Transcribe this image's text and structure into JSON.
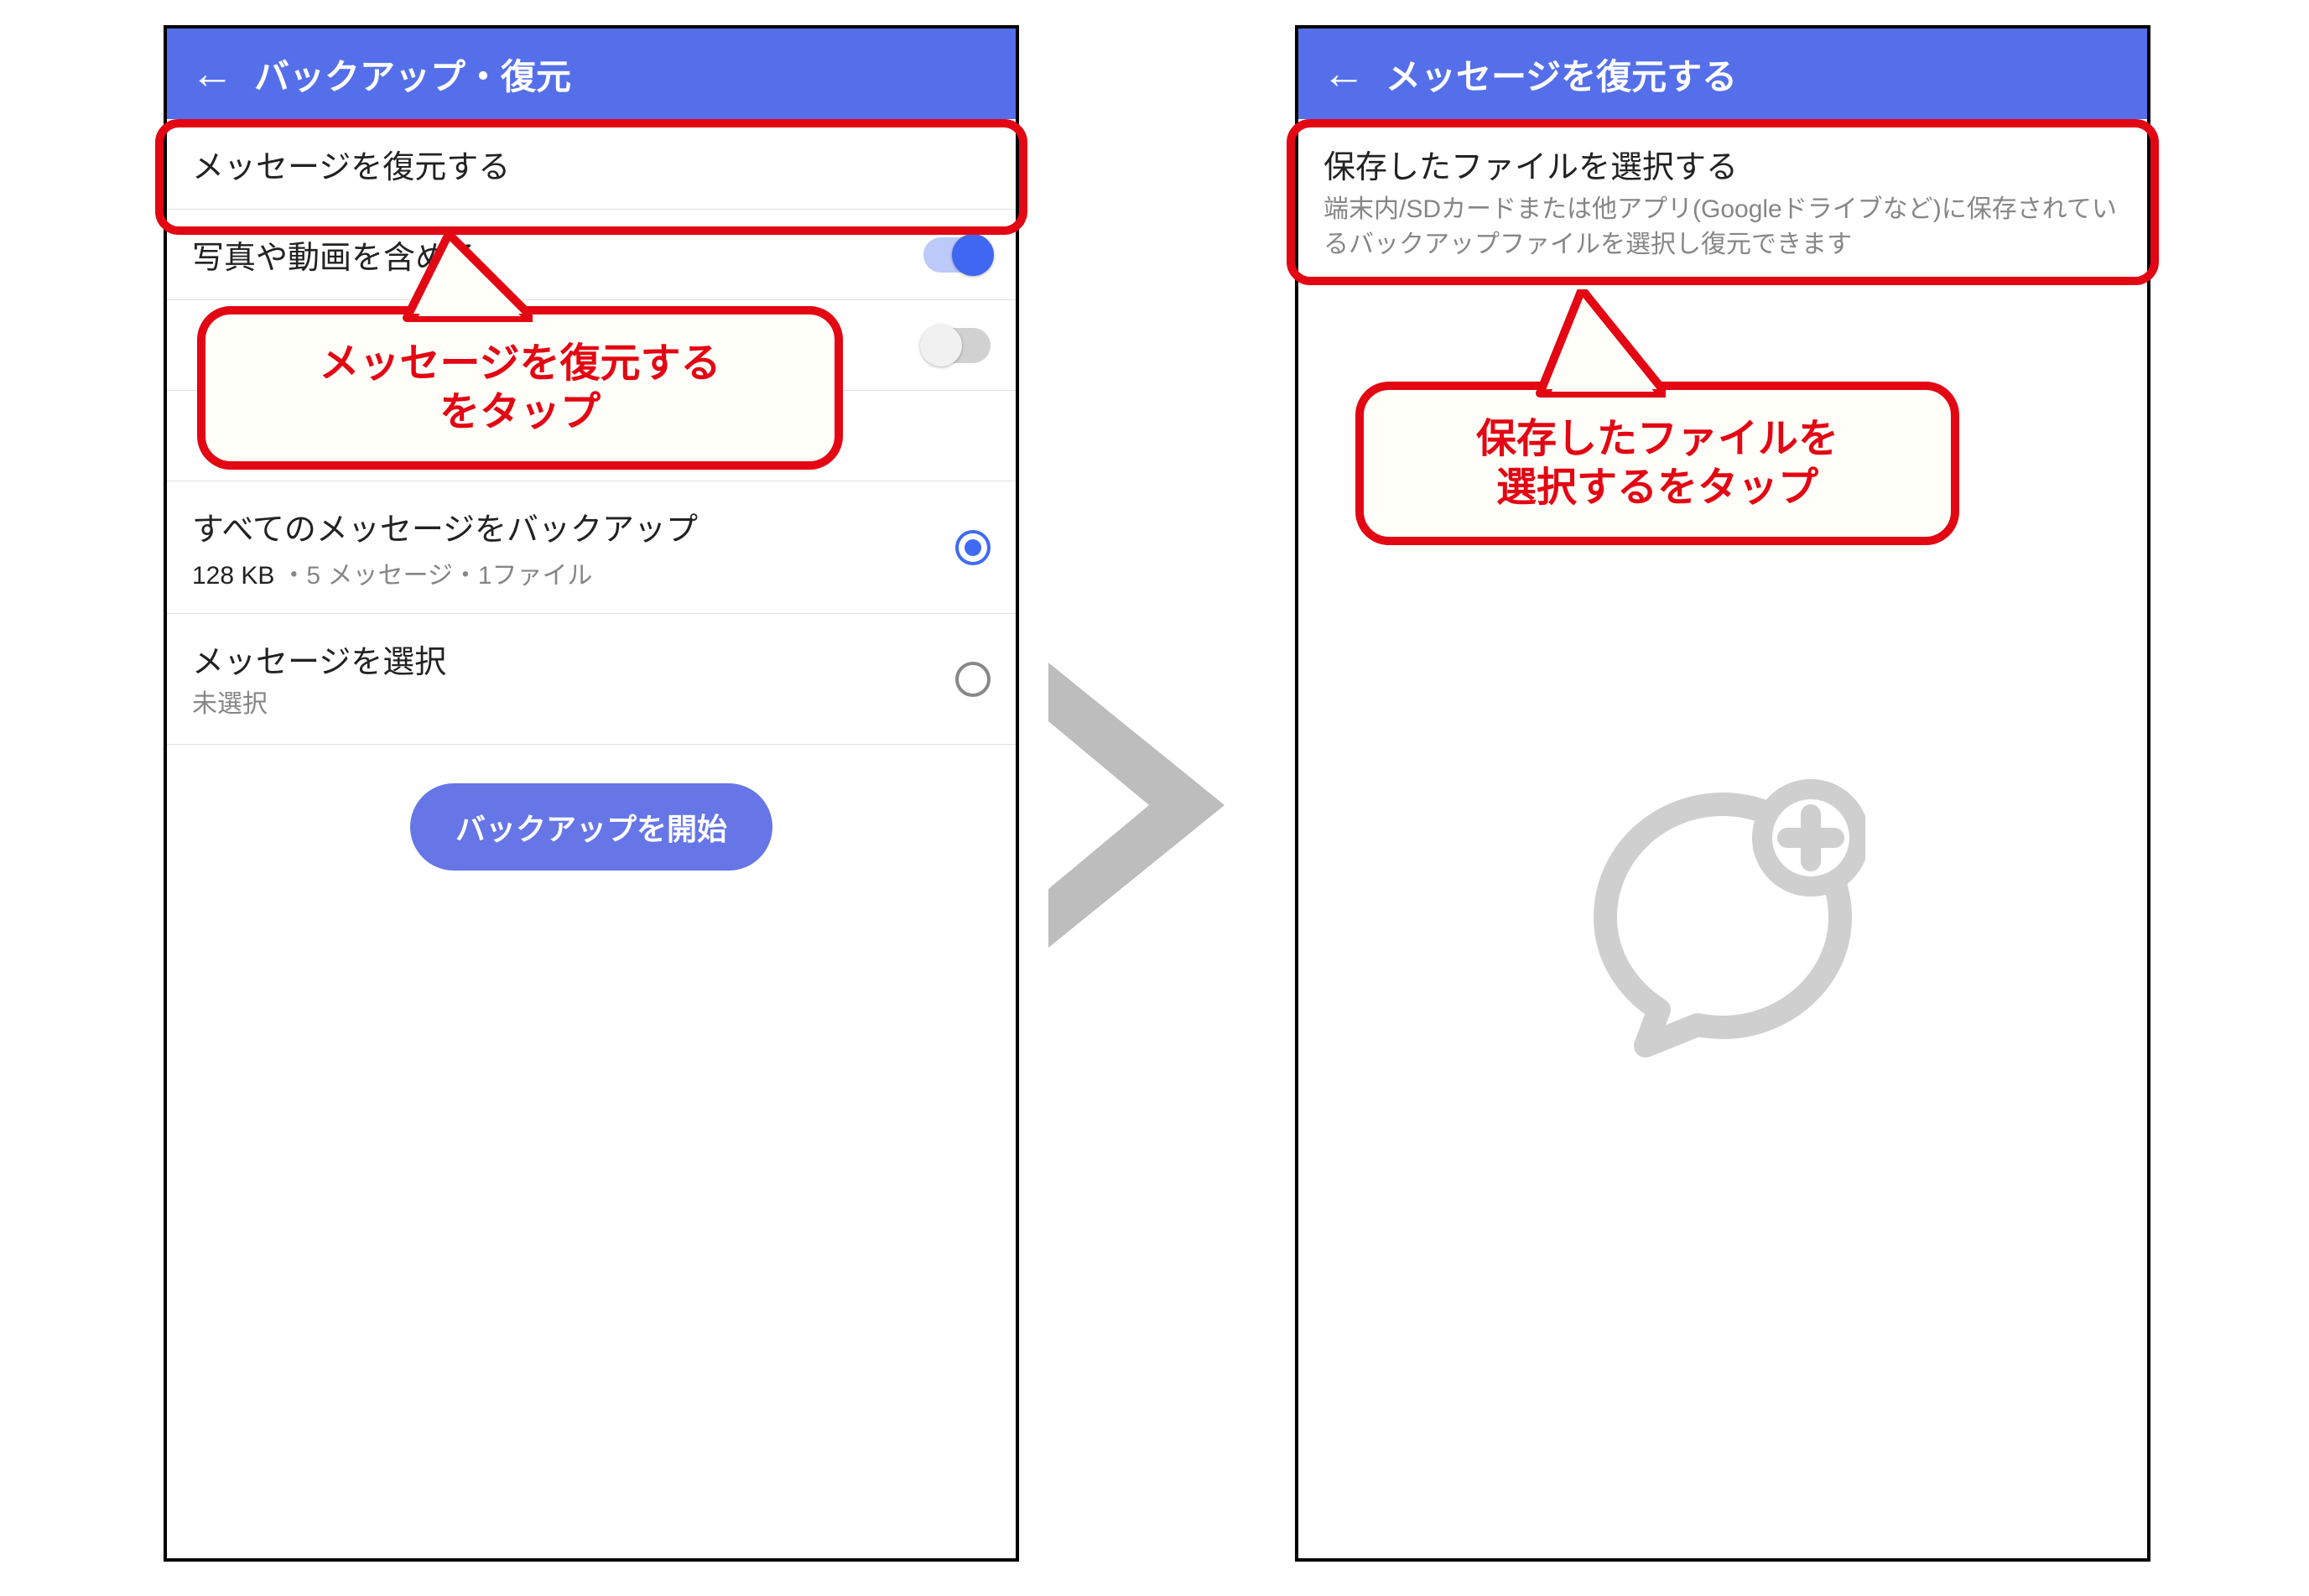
{
  "colors": {
    "header": "#556FEA",
    "accentRed": "#E30613",
    "button": "#6676E7",
    "switchOn": "#4067F1",
    "radioOn": "#3F6BF3"
  },
  "left": {
    "title": "バックアップ・復元",
    "rows": {
      "restore": "メッセージを復元する",
      "media": "写真や動画を含める",
      "backupAll": {
        "title": "すべてのメッセージをバックアップ",
        "sizePrimary": "128 KB",
        "sizeSecondary": "・5 メッセージ・1ファイル"
      },
      "select": {
        "title": "メッセージを選択",
        "sub": "未選択"
      }
    },
    "button": "バックアップを開始",
    "callout": {
      "line1": "メッセージを復元する",
      "line2": "をタップ"
    }
  },
  "right": {
    "title": "メッセージを復元する",
    "rows": {
      "pickFile": {
        "title": "保存したファイルを選択する",
        "sub": "端末内/SDカードまたは他アプリ(Googleドライブなど)に保存されているバックアップファイルを選択し復元できます"
      }
    },
    "callout": {
      "line1": "保存したファイルを",
      "line2": "選択するをタップ"
    }
  }
}
